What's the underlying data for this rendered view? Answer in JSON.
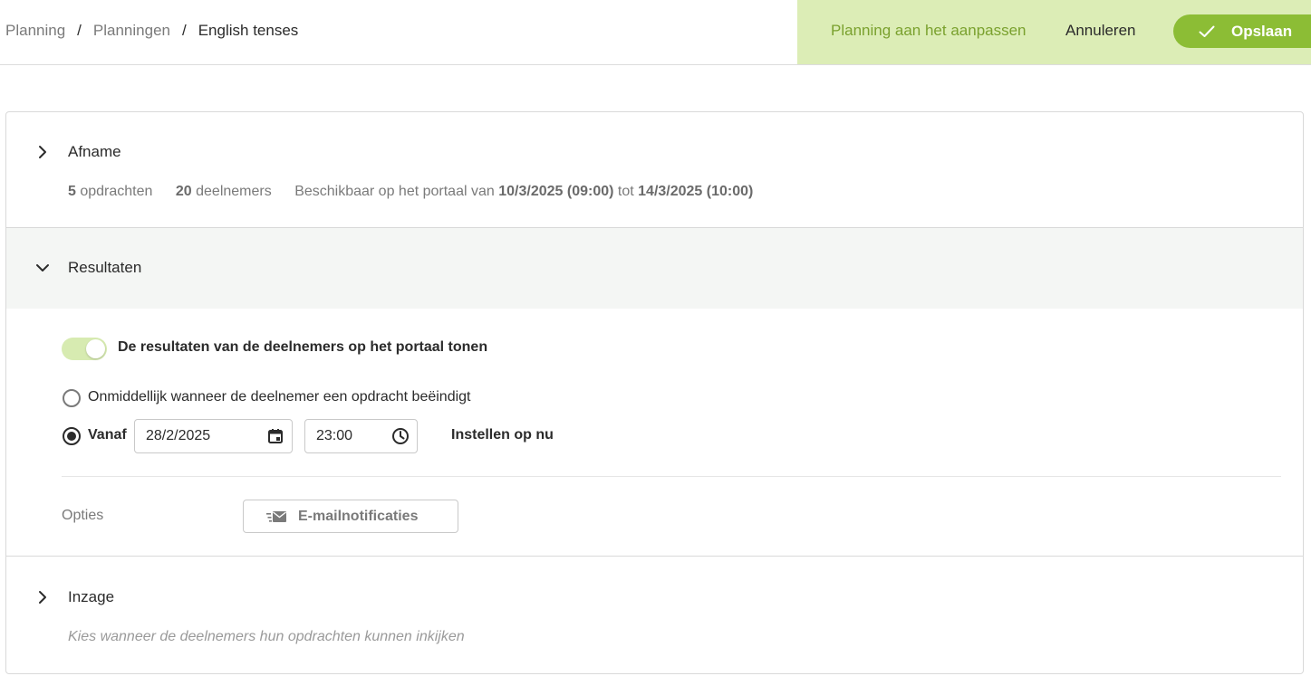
{
  "breadcrumb": {
    "items": [
      "Planning",
      "Planningen",
      "English tenses"
    ],
    "separator": "/"
  },
  "editbar": {
    "status": "Planning aan het aanpassen",
    "cancel_label": "Annuleren",
    "save_label": "Opslaan"
  },
  "afname": {
    "title": "Afname",
    "assignments_count": "5",
    "assignments_label": "opdrachten",
    "participants_count": "20",
    "participants_label": "deelnemers",
    "availability_prefix": "Beschikbaar op het portaal van",
    "start": "10/3/2025 (09:00)",
    "joiner": "tot",
    "end": "14/3/2025 (10:00)"
  },
  "resultaten": {
    "title": "Resultaten",
    "show_results_label": "De resultaten van de deelnemers op het portaal tonen",
    "show_results_on": true,
    "option_immediate": "Onmiddellijk wanneer de deelnemer een opdracht beëindigt",
    "option_from": "Vanaf",
    "selected_option": "from",
    "date_value": "28/2/2025",
    "time_value": "23:00",
    "set_now_label": "Instellen op nu",
    "options_label": "Opties",
    "email_button_label": "E-mailnotificaties"
  },
  "inzage": {
    "title": "Inzage",
    "subtitle": "Kies wanneer de deelnemers hun opdrachten kunnen inkijken"
  },
  "colors": {
    "accent": "#8cbd35",
    "editbar_bg": "#dcedb6",
    "status_text": "#7aa12e",
    "toggle_track": "#d7ebb1",
    "section_highlight": "#f4f6f4"
  }
}
